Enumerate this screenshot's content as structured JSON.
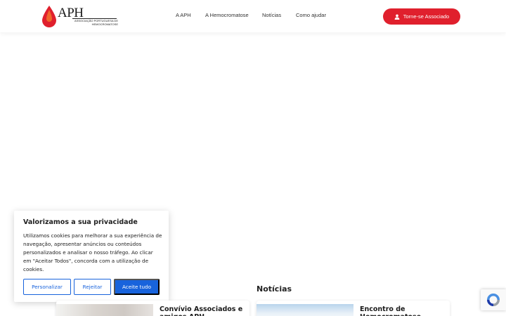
{
  "header": {
    "logo": {
      "text": "APH",
      "subtitle": "ASSOCIAÇÃO PORTUGUESA DE HEMOCROMATOSE",
      "icon": "blood-drop-icon",
      "color_red": "#e0202d"
    },
    "nav": [
      {
        "label": "A APH"
      },
      {
        "label": "A Hemocromatose"
      },
      {
        "label": "Notícias"
      },
      {
        "label": "Como ajudar"
      }
    ],
    "cta": {
      "label": "Torne-se Associado",
      "icon": "user-icon",
      "color": "#e0202d"
    }
  },
  "cookie_banner": {
    "title": "Valorizamos a sua privacidade",
    "body": "Utilizamos cookies para melhorar a sua experiência de navegação, apresentar anúncios ou conteúdos personalizados e analisar o nosso tráfego. Ao clicar em \"Aceitar Todos\", concorda com a utilização de cookies.",
    "buttons": {
      "customize": "Personalizar",
      "reject": "Rejeitar",
      "accept": "Aceite tudo"
    },
    "accent_color": "#1863dc"
  },
  "news": {
    "title": "Notícias",
    "cards": [
      {
        "title": "Convívio Associados e amigos APH"
      },
      {
        "title": "Encontro de Hemocromatose"
      }
    ]
  },
  "recaptcha": {
    "icon": "recaptcha-icon"
  }
}
